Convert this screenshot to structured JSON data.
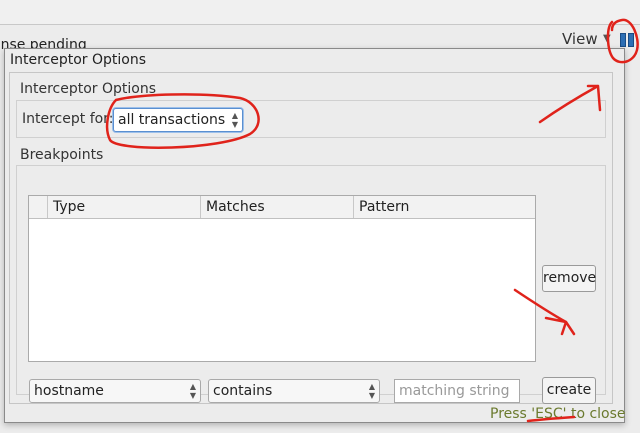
{
  "background": {
    "status_text": "onse pending",
    "view_label": "View",
    "view_arrow": "▼"
  },
  "dialog": {
    "title": "Interceptor Options",
    "interceptor_group": {
      "label": "Interceptor Options",
      "intercept_for_label": "Intercept for:",
      "intercept_for_value": "all transactions"
    },
    "breakpoints_group": {
      "label": "Breakpoints",
      "columns": [
        "",
        "Type",
        "Matches",
        "Pattern"
      ],
      "rows": [],
      "remove_label": "remove",
      "field_select_value": "hostname",
      "operator_select_value": "contains",
      "pattern_placeholder": "matching string",
      "create_label": "create"
    },
    "esc_hint": "Press 'ESC' to close"
  },
  "colors": {
    "annotation": "#e0231b",
    "pause_icon": "#2d6fb4",
    "hint_text": "#6b7a2e"
  }
}
